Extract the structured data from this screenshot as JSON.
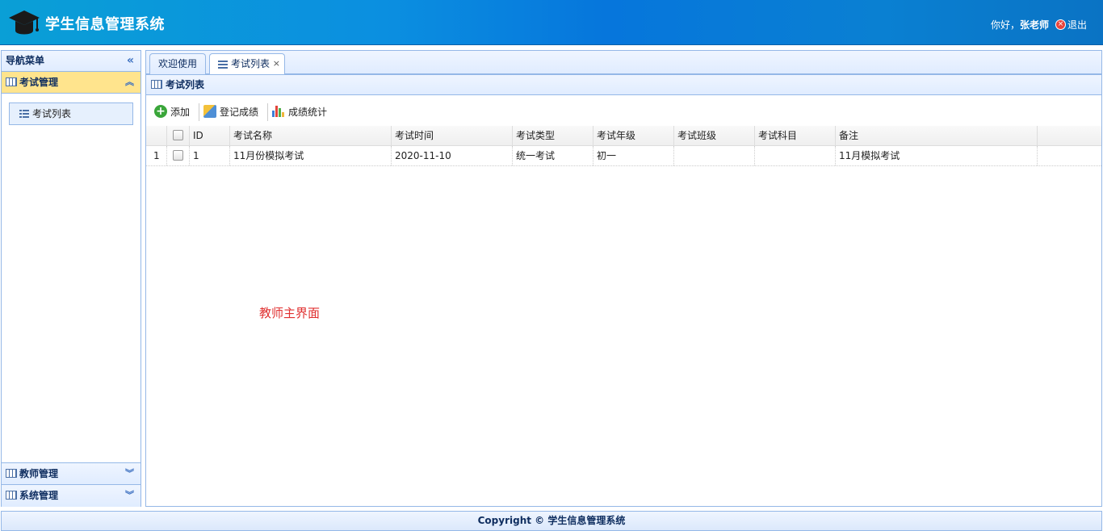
{
  "header": {
    "title": "学生信息管理系统",
    "greeting": "你好，",
    "username": "张老师",
    "logout_label": "退出",
    "logo_icon": "graduation-cap-icon"
  },
  "sidebar": {
    "title": "导航菜单",
    "sections": [
      {
        "label": "考试管理",
        "expanded": true,
        "items": [
          {
            "label": "考试列表"
          }
        ]
      },
      {
        "label": "教师管理",
        "expanded": false
      },
      {
        "label": "系统管理",
        "expanded": false
      }
    ]
  },
  "tabs": [
    {
      "label": "欢迎使用",
      "active": false
    },
    {
      "label": "考试列表",
      "active": true,
      "closable": true
    }
  ],
  "panel": {
    "title": "考试列表",
    "toolbar": {
      "add_label": "添加",
      "register_label": "登记成绩",
      "stats_label": "成绩统计"
    }
  },
  "grid": {
    "columns": [
      "ID",
      "考试名称",
      "考试时间",
      "考试类型",
      "考试年级",
      "考试班级",
      "考试科目",
      "备注"
    ],
    "rows": [
      {
        "num": "1",
        "id": "1",
        "name": "11月份模拟考试",
        "time": "2020-11-10",
        "type": "统一考试",
        "grade": "初一",
        "clazz": "",
        "course": "",
        "remark": "11月模拟考试"
      }
    ]
  },
  "note": "教师主界面",
  "footer": "Copyright © 学生信息管理系统",
  "colors": {
    "header_start": "#0a9fd6",
    "header_end": "#0a73c4",
    "active_section": "#ffe48d",
    "border": "#95b8e7",
    "note": "#e03030"
  }
}
